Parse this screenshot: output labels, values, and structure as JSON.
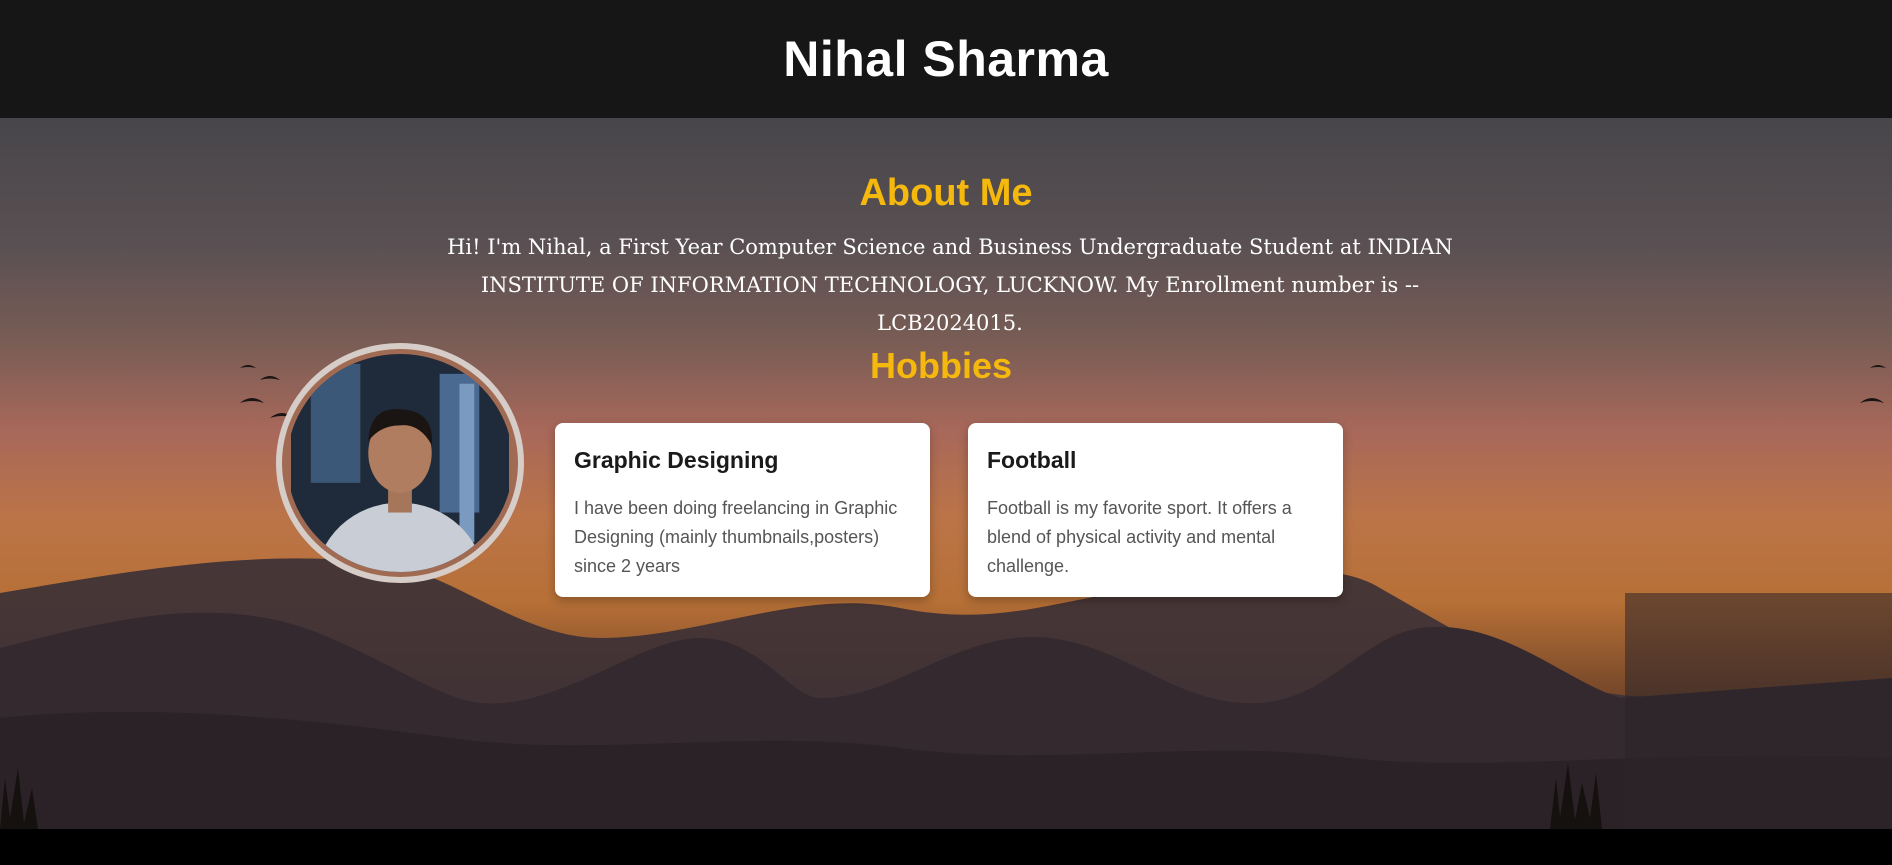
{
  "header": {
    "title": "Nihal Sharma"
  },
  "about": {
    "title": "About Me",
    "text": "Hi! I'm Nihal, a First Year Computer Science and Business Undergraduate Student at INDIAN INSTITUTE OF INFORMATION TECHNOLOGY, LUCKNOW. My Enrollment number is -- LCB2024015."
  },
  "hobbies": {
    "title": "Hobbies",
    "items": [
      {
        "title": "Graphic Designing",
        "description": "I have been doing freelancing in Graphic Designing (mainly thumbnails,posters) since 2 years"
      },
      {
        "title": "Football",
        "description": "Football is my favorite sport. It offers a blend of physical activity and mental challenge."
      }
    ]
  },
  "colors": {
    "header_bg": "#161616",
    "accent": "#f5b80d",
    "card_bg": "#ffffff"
  },
  "icons": {
    "profile": "profile-photo",
    "birds": "birds-icon"
  }
}
